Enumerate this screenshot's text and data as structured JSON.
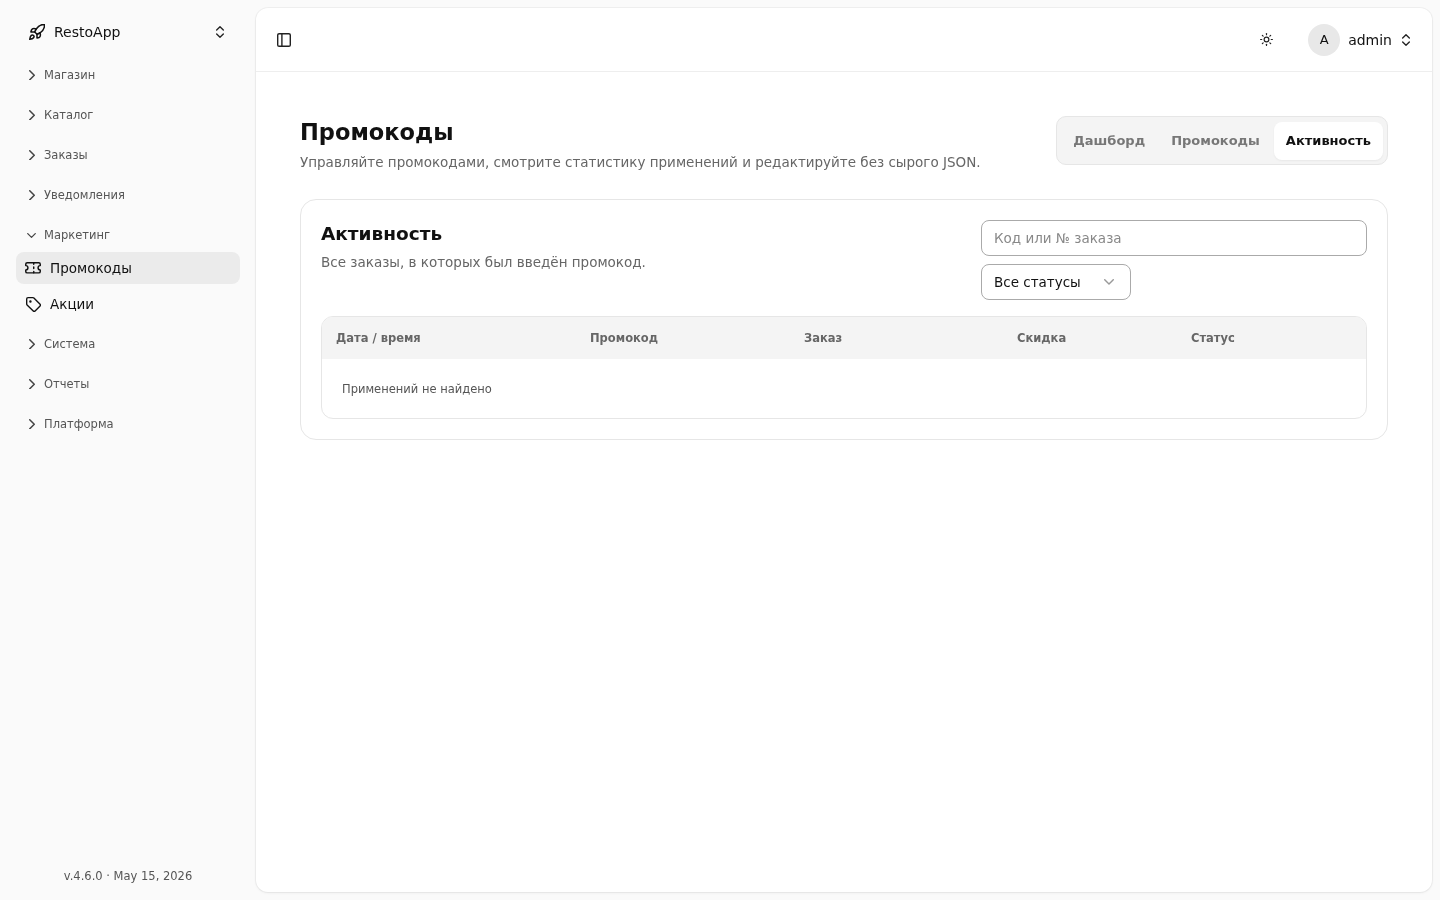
{
  "sidebar": {
    "brand": "RestoApp",
    "nav": [
      {
        "label": "Магазин",
        "expanded": false
      },
      {
        "label": "Каталог",
        "expanded": false
      },
      {
        "label": "Заказы",
        "expanded": false
      },
      {
        "label": "Уведомления",
        "expanded": false
      },
      {
        "label": "Маркетинг",
        "expanded": true,
        "children": [
          {
            "label": "Промокоды",
            "selected": true
          },
          {
            "label": "Акции",
            "selected": false
          }
        ]
      },
      {
        "label": "Система",
        "expanded": false
      },
      {
        "label": "Отчеты",
        "expanded": false
      },
      {
        "label": "Платформа",
        "expanded": false
      }
    ],
    "footer": "v.4.6.0 · May 15, 2026"
  },
  "header": {
    "user": {
      "avatar": "A",
      "name": "admin"
    }
  },
  "page": {
    "title": "Промокоды",
    "subtitle": "Управляйте промокодами, смотрите статистику применений и редактируйте без сырого JSON.",
    "tabs": [
      {
        "label": "Дашборд",
        "selected": false
      },
      {
        "label": "Промокоды",
        "selected": false
      },
      {
        "label": "Активность",
        "selected": true
      }
    ]
  },
  "card": {
    "title": "Активность",
    "subtitle": "Все заказы, в которых был введён промокод.",
    "search": {
      "placeholder": "Код или № заказа"
    },
    "status_filter": {
      "value": "Все статусы"
    },
    "table": {
      "columns": [
        "Дата / время",
        "Промокод",
        "Заказ",
        "Скидка",
        "Статус"
      ],
      "empty_message": "Применений не найдено"
    }
  }
}
